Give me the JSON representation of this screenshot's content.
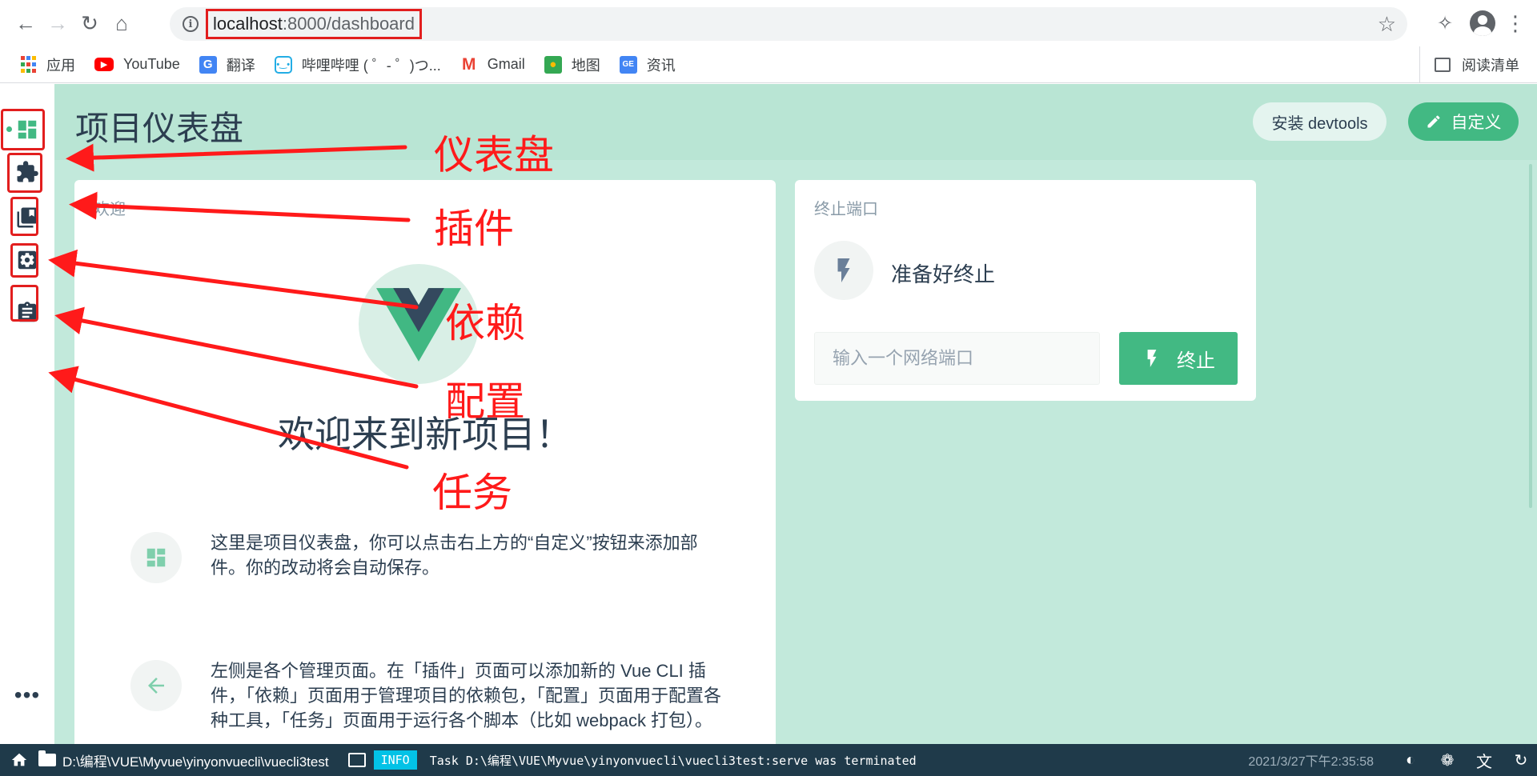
{
  "browser": {
    "url_host": "localhost",
    "url_path": ":8000/dashboard",
    "bookmarks": [
      {
        "label": "应用",
        "icon": "apps-icon"
      },
      {
        "label": "YouTube",
        "icon": "youtube-icon"
      },
      {
        "label": "翻译",
        "icon": "translate-icon"
      },
      {
        "label": "哔哩哔哩 ( ゜- ゜)つ...",
        "icon": "bilibili-icon"
      },
      {
        "label": "Gmail",
        "icon": "gmail-icon"
      },
      {
        "label": "地图",
        "icon": "maps-icon"
      },
      {
        "label": "资讯",
        "icon": "news-icon"
      }
    ],
    "reading_list": "阅读清单"
  },
  "sidebar": {
    "items": [
      {
        "name": "dashboard",
        "icon": "dashboard-icon"
      },
      {
        "name": "plugins",
        "icon": "puzzle-icon"
      },
      {
        "name": "dependencies",
        "icon": "library-icon"
      },
      {
        "name": "configuration",
        "icon": "gear-icon"
      },
      {
        "name": "tasks",
        "icon": "clipboard-icon"
      }
    ],
    "more": "•••"
  },
  "header": {
    "title": "项目仪表盘",
    "devtools_label": "安装 devtools",
    "customize_label": "自定义"
  },
  "welcome_widget": {
    "title": "欢迎",
    "heading": "欢迎来到新项目！",
    "tips": [
      {
        "icon": "dashboard-icon",
        "text": "这里是项目仪表盘，你可以点击右上方的“自定义”按钮来添加部件。你的改动将会自动保存。"
      },
      {
        "icon": "arrow-left-icon",
        "text": "左侧是各个管理页面。在「插件」页面可以添加新的 Vue CLI 插件，「依赖」页面用于管理项目的依赖包，「配置」页面用于配置各种工具，「任务」页面用于运行各个脚本（比如 webpack 打包）。"
      }
    ]
  },
  "kill_port_widget": {
    "title": "终止端口",
    "status": "准备好终止",
    "input_placeholder": "输入一个网络端口",
    "button_label": "终止"
  },
  "annotations": {
    "dashboard": "仪表盘",
    "plugins": "插件",
    "dependencies": "依赖",
    "configuration": "配置",
    "tasks": "任务"
  },
  "statusbar": {
    "path": "D:\\编程\\VUE\\Myvue\\yinyonvuecli\\vuecli3test",
    "badge": "INFO",
    "message": "Task D:\\编程\\VUE\\Myvue\\yinyonvuecli\\vuecli3test:serve was terminated",
    "time": "2021/3/27下午2:35:58"
  },
  "colors": {
    "accent": "#42b983",
    "header_bg": "#b9e5d4",
    "content_bg": "#c2e9db",
    "annotation": "#ff1a1a",
    "statusbar_bg": "#1f3a4a",
    "info_badge": "#03c2e6"
  }
}
